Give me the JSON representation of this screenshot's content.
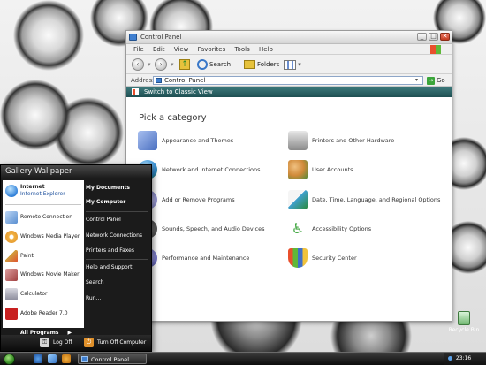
{
  "window": {
    "title": "Control Panel",
    "menu": [
      "File",
      "Edit",
      "View",
      "Favorites",
      "Tools",
      "Help"
    ],
    "toolbar": {
      "search_label": "Search",
      "folders_label": "Folders"
    },
    "address": {
      "label": "Address",
      "value": "Control Panel",
      "go_label": "Go"
    },
    "classic_view_link": "Switch to Classic View",
    "pick_title": "Pick a category",
    "categories": [
      {
        "label": "Appearance and Themes",
        "icon": "appearance-icon",
        "color": "#6f8fd6"
      },
      {
        "label": "Printers and Other Hardware",
        "icon": "printer-icon",
        "color": "#8a8a8a"
      },
      {
        "label": "Network and Internet Connections",
        "icon": "globe-icon",
        "color": "#2f8fd8"
      },
      {
        "label": "User Accounts",
        "icon": "users-icon",
        "color": "#d08a3a"
      },
      {
        "label": "Add or Remove Programs",
        "icon": "cd-icon",
        "color": "#9a9ad8"
      },
      {
        "label": "Date, Time, Language, and Regional Options",
        "icon": "calendar-globe-icon",
        "color": "#3fa0d0"
      },
      {
        "label": "Sounds, Speech, and Audio Devices",
        "icon": "speaker-icon",
        "color": "#707070"
      },
      {
        "label": "Accessibility Options",
        "icon": "accessibility-icon",
        "color": "#3fa53f"
      },
      {
        "label": "Performance and Maintenance",
        "icon": "gauge-icon",
        "color": "#7a7ad0"
      },
      {
        "label": "Security Center",
        "icon": "shield-icon",
        "color": "#3f6fc8"
      }
    ]
  },
  "start_menu": {
    "title": "Gallery Wallpaper",
    "pinned": {
      "name": "Internet",
      "sub": "Internet Explorer"
    },
    "left_items": [
      {
        "label": "Remote Connection",
        "icon": "remote-connection-icon",
        "color": "#5a8fd0"
      },
      {
        "label": "Windows Media Player",
        "icon": "media-player-icon",
        "color": "#e0902a"
      },
      {
        "label": "Paint",
        "icon": "paint-icon",
        "color": "#d0a040"
      },
      {
        "label": "Windows Movie Maker",
        "icon": "movie-maker-icon",
        "color": "#a04040"
      },
      {
        "label": "Calculator",
        "icon": "calculator-icon",
        "color": "#8a8a9a"
      },
      {
        "label": "Adobe Reader 7.0",
        "icon": "adobe-reader-icon",
        "color": "#c82020"
      }
    ],
    "all_programs": "All Programs",
    "right_items": [
      {
        "label": "My Documents",
        "bold": true
      },
      {
        "label": "My Computer",
        "bold": true
      },
      {
        "label": "Control Panel",
        "bold": false
      },
      {
        "label": "Network Connections",
        "bold": false
      },
      {
        "label": "Printers and Faxes",
        "bold": false
      },
      {
        "label": "Help and Support",
        "bold": false
      },
      {
        "label": "Search",
        "bold": false
      },
      {
        "label": "Run...",
        "bold": false
      }
    ],
    "log_off": "Log Off",
    "turn_off": "Turn Off Computer"
  },
  "desktop": {
    "recycle_bin": "Recycle Bin"
  },
  "taskbar": {
    "task": "Control Panel",
    "clock": "23:16"
  }
}
